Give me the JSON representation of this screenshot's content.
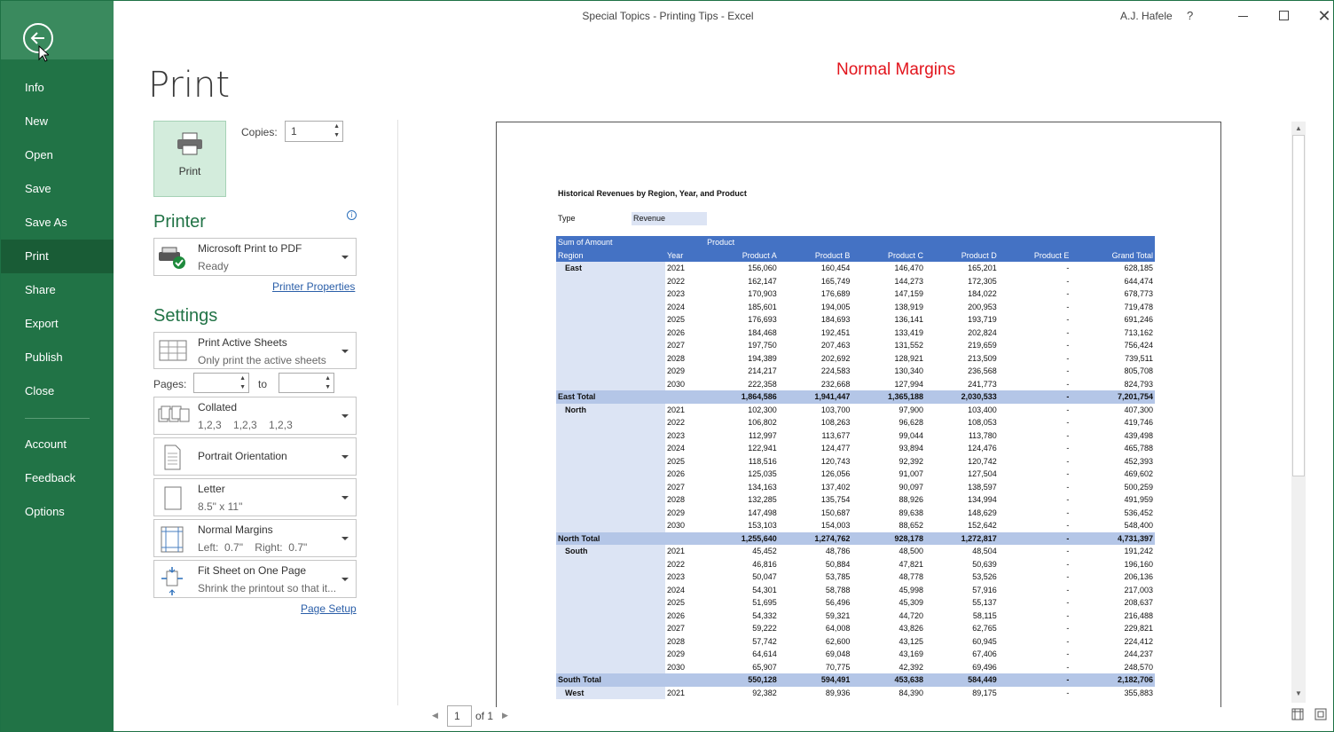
{
  "window": {
    "title": "Special Topics - Printing Tips  -  Excel",
    "user": "A.J. Hafele",
    "help": "?",
    "close": "✕"
  },
  "sidebar": {
    "items": [
      {
        "label": "Info"
      },
      {
        "label": "New"
      },
      {
        "label": "Open"
      },
      {
        "label": "Save"
      },
      {
        "label": "Save As"
      },
      {
        "label": "Print"
      },
      {
        "label": "Share"
      },
      {
        "label": "Export"
      },
      {
        "label": "Publish"
      },
      {
        "label": "Close"
      },
      {
        "label": "Account"
      },
      {
        "label": "Feedback"
      },
      {
        "label": "Options"
      }
    ],
    "active": "Print"
  },
  "print": {
    "title": "Print",
    "button_label": "Print",
    "copies_label": "Copies:",
    "copies_value": "1"
  },
  "printer": {
    "heading": "Printer",
    "name": "Microsoft Print to PDF",
    "status": "Ready",
    "properties_link": "Printer Properties"
  },
  "settings": {
    "heading": "Settings",
    "what": {
      "title": "Print Active Sheets",
      "sub": "Only print the active sheets"
    },
    "pages_label": "Pages:",
    "to_label": "to",
    "collation": {
      "title": "Collated",
      "sub": "1,2,3    1,2,3    1,2,3"
    },
    "orientation": {
      "title": "Portrait Orientation"
    },
    "paper": {
      "title": "Letter",
      "sub": "8.5\" x 11\""
    },
    "margins": {
      "title": "Normal Margins",
      "sub": "Left:  0.7\"    Right:  0.7\""
    },
    "scaling": {
      "title": "Fit Sheet on One Page",
      "sub": "Shrink the printout so that it..."
    },
    "page_setup_link": "Page Setup"
  },
  "preview": {
    "annotation": "Normal Margins",
    "sheet_title": "Historical Revenues by Region, Year, and Product",
    "filter_label": "Type",
    "filter_value": "Revenue",
    "header1": {
      "a": "Sum of Amount",
      "b": "Product"
    },
    "columns": [
      "Region",
      "Year",
      "Product A",
      "Product B",
      "Product C",
      "Product D",
      "Product E",
      "Grand Total"
    ],
    "groups": [
      {
        "region": "East",
        "rows": [
          [
            "2021",
            "156,060",
            "160,454",
            "146,470",
            "165,201",
            "-",
            "628,185"
          ],
          [
            "2022",
            "162,147",
            "165,749",
            "144,273",
            "172,305",
            "-",
            "644,474"
          ],
          [
            "2023",
            "170,903",
            "176,689",
            "147,159",
            "184,022",
            "-",
            "678,773"
          ],
          [
            "2024",
            "185,601",
            "194,005",
            "138,919",
            "200,953",
            "-",
            "719,478"
          ],
          [
            "2025",
            "176,693",
            "184,693",
            "136,141",
            "193,719",
            "-",
            "691,246"
          ],
          [
            "2026",
            "184,468",
            "192,451",
            "133,419",
            "202,824",
            "-",
            "713,162"
          ],
          [
            "2027",
            "197,750",
            "207,463",
            "131,552",
            "219,659",
            "-",
            "756,424"
          ],
          [
            "2028",
            "194,389",
            "202,692",
            "128,921",
            "213,509",
            "-",
            "739,511"
          ],
          [
            "2029",
            "214,217",
            "224,583",
            "130,340",
            "236,568",
            "-",
            "805,708"
          ],
          [
            "2030",
            "222,358",
            "232,668",
            "127,994",
            "241,773",
            "-",
            "824,793"
          ]
        ],
        "total": [
          "East Total",
          "1,864,586",
          "1,941,447",
          "1,365,188",
          "2,030,533",
          "-",
          "7,201,754"
        ]
      },
      {
        "region": "North",
        "rows": [
          [
            "2021",
            "102,300",
            "103,700",
            "97,900",
            "103,400",
            "-",
            "407,300"
          ],
          [
            "2022",
            "106,802",
            "108,263",
            "96,628",
            "108,053",
            "-",
            "419,746"
          ],
          [
            "2023",
            "112,997",
            "113,677",
            "99,044",
            "113,780",
            "-",
            "439,498"
          ],
          [
            "2024",
            "122,941",
            "124,477",
            "93,894",
            "124,476",
            "-",
            "465,788"
          ],
          [
            "2025",
            "118,516",
            "120,743",
            "92,392",
            "120,742",
            "-",
            "452,393"
          ],
          [
            "2026",
            "125,035",
            "126,056",
            "91,007",
            "127,504",
            "-",
            "469,602"
          ],
          [
            "2027",
            "134,163",
            "137,402",
            "90,097",
            "138,597",
            "-",
            "500,259"
          ],
          [
            "2028",
            "132,285",
            "135,754",
            "88,926",
            "134,994",
            "-",
            "491,959"
          ],
          [
            "2029",
            "147,498",
            "150,687",
            "89,638",
            "148,629",
            "-",
            "536,452"
          ],
          [
            "2030",
            "153,103",
            "154,003",
            "88,652",
            "152,642",
            "-",
            "548,400"
          ]
        ],
        "total": [
          "North Total",
          "1,255,640",
          "1,274,762",
          "928,178",
          "1,272,817",
          "-",
          "4,731,397"
        ]
      },
      {
        "region": "South",
        "rows": [
          [
            "2021",
            "45,452",
            "48,786",
            "48,500",
            "48,504",
            "-",
            "191,242"
          ],
          [
            "2022",
            "46,816",
            "50,884",
            "47,821",
            "50,639",
            "-",
            "196,160"
          ],
          [
            "2023",
            "50,047",
            "53,785",
            "48,778",
            "53,526",
            "-",
            "206,136"
          ],
          [
            "2024",
            "54,301",
            "58,788",
            "45,998",
            "57,916",
            "-",
            "217,003"
          ],
          [
            "2025",
            "51,695",
            "56,496",
            "45,309",
            "55,137",
            "-",
            "208,637"
          ],
          [
            "2026",
            "54,332",
            "59,321",
            "44,720",
            "58,115",
            "-",
            "216,488"
          ],
          [
            "2027",
            "59,222",
            "64,008",
            "43,826",
            "62,765",
            "-",
            "229,821"
          ],
          [
            "2028",
            "57,742",
            "62,600",
            "43,125",
            "60,945",
            "-",
            "224,412"
          ],
          [
            "2029",
            "64,614",
            "69,048",
            "43,169",
            "67,406",
            "-",
            "244,237"
          ],
          [
            "2030",
            "65,907",
            "70,775",
            "42,392",
            "69,496",
            "-",
            "248,570"
          ]
        ],
        "total": [
          "South Total",
          "550,128",
          "594,491",
          "453,638",
          "584,449",
          "-",
          "2,182,706"
        ]
      },
      {
        "region": "West",
        "rows": [
          [
            "2021",
            "92,382",
            "89,936",
            "84,390",
            "89,175",
            "-",
            "355,883"
          ]
        ]
      }
    ],
    "page_number": "1",
    "of_pages": "of 1"
  }
}
